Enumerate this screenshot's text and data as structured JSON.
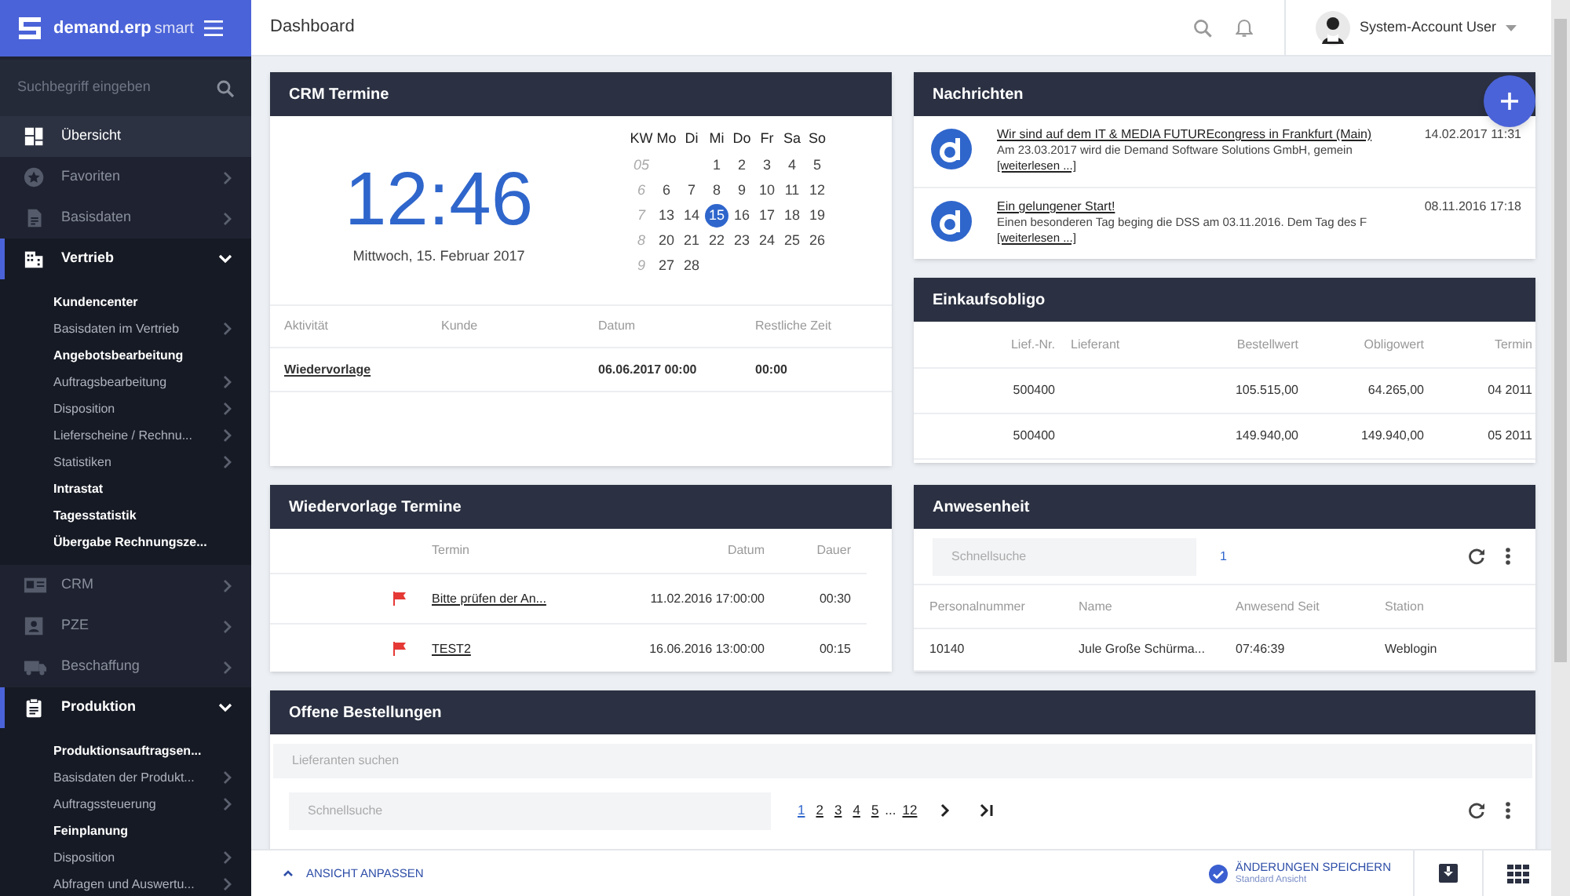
{
  "app": {
    "name": "demand.erp",
    "edition": "smart"
  },
  "sidebar": {
    "search_placeholder": "Suchbegriff eingeben",
    "items": [
      {
        "label": "Übersicht",
        "selected": true,
        "expanded": false,
        "has_submenu": false
      },
      {
        "label": "Favoriten",
        "selected": false,
        "expanded": false,
        "has_submenu": true
      },
      {
        "label": "Basisdaten",
        "selected": false,
        "expanded": false,
        "has_submenu": true
      },
      {
        "label": "Vertrieb",
        "selected": false,
        "expanded": true,
        "has_submenu": true,
        "children": [
          {
            "label": "Kundencenter",
            "has_submenu": false
          },
          {
            "label": "Basisdaten im Vertrieb",
            "has_submenu": true
          },
          {
            "label": "Angebotsbearbeitung",
            "has_submenu": false
          },
          {
            "label": "Auftragsbearbeitung",
            "has_submenu": true
          },
          {
            "label": "Disposition",
            "has_submenu": true
          },
          {
            "label": "Lieferscheine / Rechnu...",
            "has_submenu": true
          },
          {
            "label": "Statistiken",
            "has_submenu": true
          },
          {
            "label": "Intrastat",
            "has_submenu": false
          },
          {
            "label": "Tagesstatistik",
            "has_submenu": false
          },
          {
            "label": "Übergabe Rechnungsze...",
            "has_submenu": false
          }
        ]
      },
      {
        "label": "CRM",
        "selected": false,
        "expanded": false,
        "has_submenu": true
      },
      {
        "label": "PZE",
        "selected": false,
        "expanded": false,
        "has_submenu": true
      },
      {
        "label": "Beschaffung",
        "selected": false,
        "expanded": false,
        "has_submenu": true
      },
      {
        "label": "Produktion",
        "selected": false,
        "expanded": true,
        "has_submenu": true,
        "children": [
          {
            "label": "Produktionsauftragsen...",
            "has_submenu": false
          },
          {
            "label": "Basisdaten der Produkt...",
            "has_submenu": true
          },
          {
            "label": "Auftragssteuerung",
            "has_submenu": true
          },
          {
            "label": "Feinplanung",
            "has_submenu": false
          },
          {
            "label": "Disposition",
            "has_submenu": true
          },
          {
            "label": "Abfragen und Auswertu...",
            "has_submenu": true
          }
        ]
      }
    ]
  },
  "header": {
    "title": "Dashboard",
    "user": "System-Account User"
  },
  "crm_termine": {
    "title": "CRM Termine",
    "time": "12:46",
    "date": "Mittwoch, 15. Februar 2017",
    "calendar": {
      "weekdays": [
        "KW",
        "Mo",
        "Di",
        "Mi",
        "Do",
        "Fr",
        "Sa",
        "So"
      ],
      "weeks": [
        {
          "kw": "05",
          "days": [
            {
              "d": "1",
              "selected": false
            },
            {
              "d": "2",
              "selected": false
            },
            {
              "d": "3",
              "selected": false
            },
            {
              "d": "4",
              "selected": false
            },
            {
              "d": "5",
              "selected": false
            }
          ]
        },
        {
          "kw": "6",
          "days": [
            {
              "d": "6",
              "selected": false
            },
            {
              "d": "7",
              "selected": false
            },
            {
              "d": "8",
              "selected": false
            },
            {
              "d": "9",
              "selected": false
            },
            {
              "d": "10",
              "selected": false
            },
            {
              "d": "11",
              "selected": false
            },
            {
              "d": "12",
              "selected": false
            }
          ]
        },
        {
          "kw": "7",
          "days": [
            {
              "d": "13",
              "selected": false
            },
            {
              "d": "14",
              "selected": false
            },
            {
              "d": "15",
              "selected": true
            },
            {
              "d": "16",
              "selected": false
            },
            {
              "d": "17",
              "selected": false
            },
            {
              "d": "18",
              "selected": false
            },
            {
              "d": "19",
              "selected": false
            }
          ]
        },
        {
          "kw": "8",
          "days": [
            {
              "d": "20",
              "selected": false
            },
            {
              "d": "21",
              "selected": false
            },
            {
              "d": "22",
              "selected": false
            },
            {
              "d": "23",
              "selected": false
            },
            {
              "d": "24",
              "selected": false
            },
            {
              "d": "25",
              "selected": false
            },
            {
              "d": "26",
              "selected": false
            }
          ]
        },
        {
          "kw": "9",
          "days": [
            {
              "d": "27",
              "selected": false
            },
            {
              "d": "28",
              "selected": false
            }
          ]
        }
      ]
    },
    "columns": [
      "Aktivität",
      "Kunde",
      "Datum",
      "Restliche Zeit"
    ],
    "rows": [
      {
        "aktivitaet": "Wiedervorlage",
        "datum": "06.06.2017 00:00",
        "restliche_zeit": "00:00"
      }
    ]
  },
  "nachrichten": {
    "title": "Nachrichten",
    "items": [
      {
        "title": "Wir sind auf dem IT & MEDIA FUTUREcongress in Frankfurt (Main)",
        "text": "Am 23.03.2017 wird die Demand Software Solutions GmbH, gemein",
        "link": "[weiterlesen ...]",
        "date": "14.02.2017 11:31"
      },
      {
        "title": "Ein gelungener Start!",
        "text": "Einen besonderen Tag beging die DSS am 03.11.2016. Dem Tag des F",
        "link": "[weiterlesen ...]",
        "date": "08.11.2016 17:18"
      }
    ]
  },
  "einkaufsobligo": {
    "title": "Einkaufsobligo",
    "columns": [
      "Lief.-Nr.",
      "Lieferant",
      "Bestellwert",
      "Obligowert",
      "Termin"
    ],
    "rows": [
      {
        "lief_nr": "500400",
        "bestellwert": "105.515,00",
        "obligowert": "64.265,00",
        "termin": "04 2011"
      },
      {
        "lief_nr": "500400",
        "bestellwert": "149.940,00",
        "obligowert": "149.940,00",
        "termin": "05 2011"
      }
    ]
  },
  "wiedervorlage": {
    "title": "Wiedervorlage Termine",
    "columns": [
      "Termin",
      "Datum",
      "Dauer"
    ],
    "rows": [
      {
        "flagged": true,
        "termin": "Bitte prüfen der An...",
        "datum": "11.02.2016 17:00:00",
        "dauer": "00:30"
      },
      {
        "flagged": true,
        "termin": "TEST2",
        "datum": "16.06.2016 13:00:00",
        "dauer": "00:15"
      }
    ]
  },
  "anwesenheit": {
    "title": "Anwesenheit",
    "search_placeholder": "Schnellsuche",
    "pages": [
      {
        "label": "1",
        "selected": true
      }
    ],
    "columns": [
      "Personalnummer",
      "Name",
      "Anwesend Seit",
      "Station"
    ],
    "rows": [
      [
        "10140",
        "Jule Große Schürma...",
        "07:46:39",
        "Weblogin"
      ]
    ]
  },
  "offene_bestellungen": {
    "title": "Offene Bestellungen",
    "supplier_placeholder": "Lieferanten suchen",
    "search_placeholder": "Schnellsuche",
    "pages": [
      {
        "kind": "page",
        "label": "1",
        "selected": true
      },
      {
        "kind": "page",
        "label": "2",
        "selected": false
      },
      {
        "kind": "page",
        "label": "3",
        "selected": false
      },
      {
        "kind": "page",
        "label": "4",
        "selected": false
      },
      {
        "kind": "page",
        "label": "5",
        "selected": false
      },
      {
        "kind": "gap",
        "label": "..."
      },
      {
        "kind": "page",
        "label": "12",
        "selected": false
      }
    ]
  },
  "footer": {
    "customize": "ANSICHT ANPASSEN",
    "save": "ÄNDERUNGEN SPEICHERN",
    "save_sub": "Standard Ansicht"
  }
}
